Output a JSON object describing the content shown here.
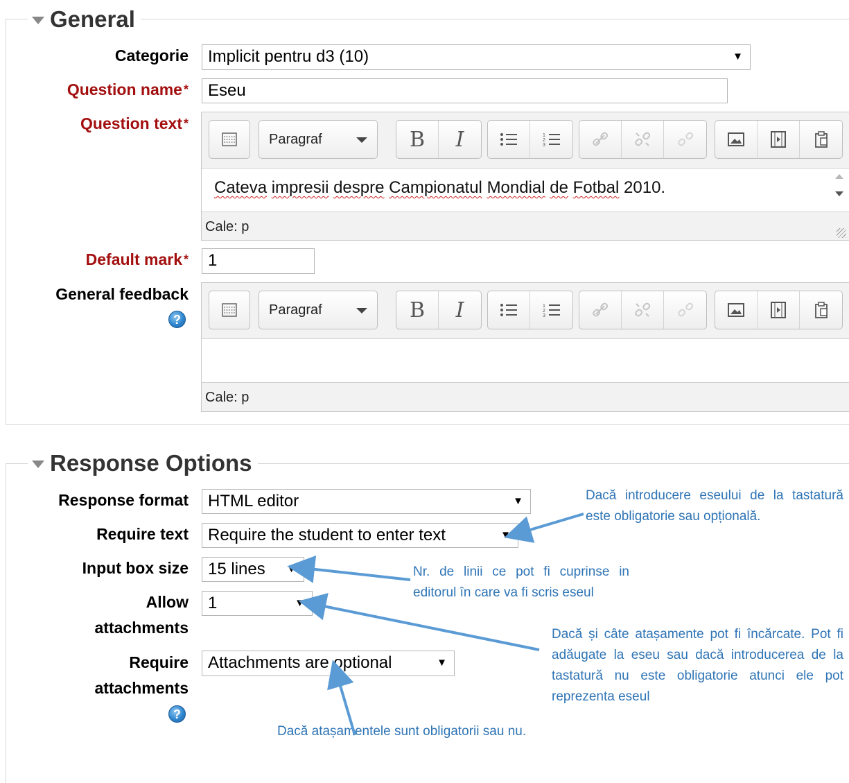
{
  "general": {
    "legend": "General",
    "categorie_label": "Categorie",
    "categorie_value": "Implicit pentru d3 (10)",
    "question_name_label": "Question name",
    "question_name_value": "Eseu",
    "question_text_label": "Question text",
    "editor_paragraph": "Paragraf",
    "question_text_content": [
      "Cateva",
      "impresii",
      "despre",
      "Campionatul",
      "Mondial",
      "de",
      "Fotbal",
      "2010."
    ],
    "path_label": "Cale: p",
    "default_mark_label": "Default mark",
    "default_mark_value": "1",
    "general_feedback_label": "General feedback",
    "required_star": "*",
    "help_glyph": "?"
  },
  "response_options": {
    "legend": "Response Options",
    "response_format_label": "Response format",
    "response_format_value": "HTML editor",
    "require_text_label": "Require text",
    "require_text_value": "Require the student to enter text",
    "input_box_size_label": "Input box size",
    "input_box_size_value": "15 lines",
    "allow_attachments_label_1": "Allow",
    "allow_attachments_label_2": "attachments",
    "allow_attachments_value": "1",
    "require_attachments_label_1": "Require",
    "require_attachments_label_2": "attachments",
    "require_attachments_value": "Attachments are optional",
    "select_arrow": "▼"
  },
  "annotations": {
    "require_text_note": "Dacă introducere eseului de la tastatură este obligatorie sau opțională.",
    "input_box_note": "Nr. de linii ce pot fi cuprinse in editorul în care va fi scris eseul",
    "allow_attachments_note": "Dacă și câte atașamente pot fi încărcate. Pot fi adăugate la eseu sau dacă introducerea de la tastatură nu este obligatorie atunci ele pot reprezenta eseul",
    "require_attachments_note": "Dacă atașamentele sunt obligatorii sau nu."
  },
  "colors": {
    "required": "#a30f0f",
    "annotation": "#2e74b5",
    "arrow": "#5b9bd5"
  },
  "icons": [
    "toolbar-toggle-icon",
    "bold-icon",
    "italic-icon",
    "unordered-list-icon",
    "ordered-list-icon",
    "link-icon",
    "unlink-icon",
    "anchor-icon",
    "image-icon",
    "media-icon",
    "paste-icon",
    "help-icon"
  ]
}
